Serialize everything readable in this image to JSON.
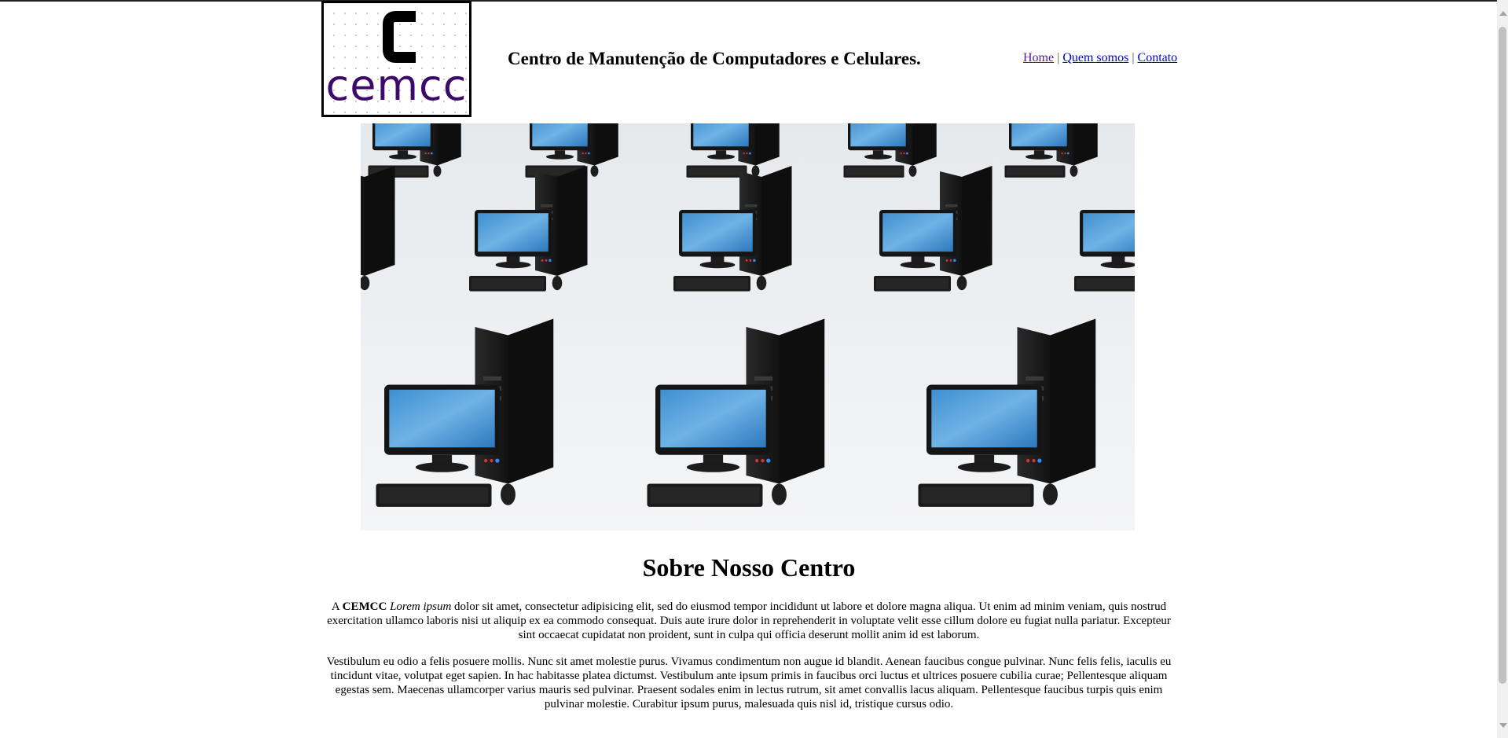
{
  "header": {
    "logo_text": "cemcc",
    "title": "Centro de Manutenção de Computadores e Celulares.",
    "nav": {
      "home": "Home",
      "about": "Quem somos",
      "contact": "Contato",
      "separator": "|"
    }
  },
  "hero": {
    "description_icon": "computer-workstations-image"
  },
  "about": {
    "heading": "Sobre Nosso Centro",
    "p1_prefix": "A",
    "p1_brand": "CEMCC",
    "p1_italic": "Lorem ipsum",
    "p1_rest": "dolor sit amet, consectetur adipisicing elit, sed do eiusmod tempor incididunt ut labore et dolore magna aliqua. Ut enim ad minim veniam, quis nostrud exercitation ullamco laboris nisi ut aliquip ex ea commodo consequat. Duis aute irure dolor in reprehenderit in voluptate velit esse cillum dolore eu fugiat nulla pariatur. Excepteur sint occaecat cupidatat non proident, sunt in culpa qui officia deserunt mollit anim id est laborum.",
    "p2": "Vestibulum eu odio a felis posuere mollis. Nunc sit amet molestie purus. Vivamus condimentum non augue id blandit. Aenean faucibus congue pulvinar. Nunc felis felis, iaculis eu tincidunt vitae, volutpat eget sapien. In hac habitasse platea dictumst. Vestibulum ante ipsum primis in faucibus orci luctus et ultrices posuere cubilia curae; Pellentesque aliquam egestas sem. Maecenas ullamcorper varius mauris sed pulvinar. Praesent sodales enim in lectus rutrum, sit amet convallis lacus aliquam. Pellentesque faucibus turpis quis enim pulvinar molestie. Curabitur ipsum purus, malesuada quis nisl id, tristique cursus odio."
  },
  "colors": {
    "logo_text": "#3d0a6b",
    "link": "#0000ee",
    "link_visited": "#551a8b"
  }
}
